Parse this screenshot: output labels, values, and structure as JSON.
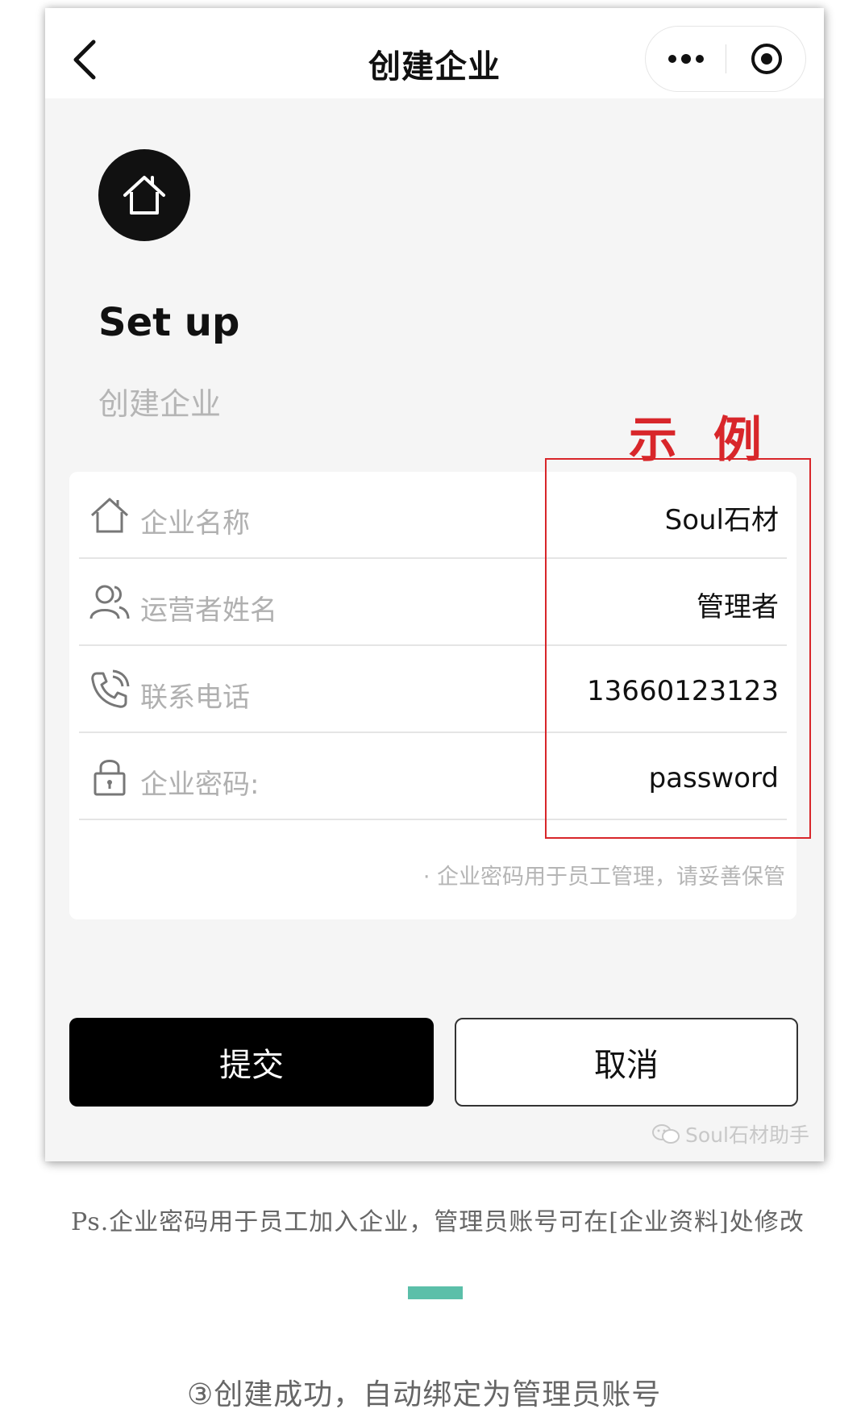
{
  "navbar": {
    "title": "创建企业"
  },
  "header": {
    "title": "Set up",
    "subtitle": "创建企业"
  },
  "annotation": {
    "example_label": "示 例",
    "highlight_color": "#d8262a"
  },
  "form": {
    "fields": [
      {
        "label": "企业名称",
        "value": "Soul石材",
        "icon": "home-icon"
      },
      {
        "label": "运营者姓名",
        "value": "管理者",
        "icon": "user-icon"
      },
      {
        "label": "联系电话",
        "value": "13660123123",
        "icon": "phone-icon"
      },
      {
        "label": "企业密码:",
        "value": "password",
        "icon": "lock-icon"
      }
    ],
    "hint": "· 企业密码用于员工管理，请妥善保管"
  },
  "actions": {
    "submit_label": "提交",
    "cancel_label": "取消"
  },
  "watermark": "Soul石材助手",
  "footer": {
    "ps_note": "Ps.企业密码用于员工加入企业，管理员账号可在[企业资料]处修改",
    "step_caption": "③创建成功，自动绑定为管理员账号"
  },
  "colors": {
    "accent_teal": "#5bbfa9",
    "button_dark": "#000000",
    "page_bg": "#f5f5f5"
  }
}
